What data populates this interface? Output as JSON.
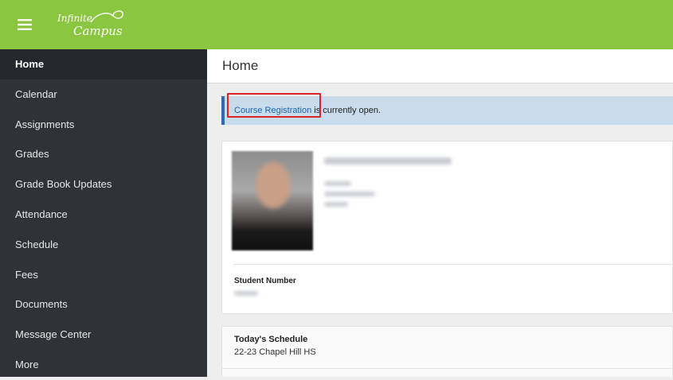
{
  "app": {
    "logo_line1": "Infinite",
    "logo_line2": "Campus",
    "brand_color": "#8ac640",
    "sidebar_color": "#2f3338"
  },
  "sidebar": {
    "items": [
      {
        "label": "Home",
        "active": true
      },
      {
        "label": "Calendar"
      },
      {
        "label": "Assignments"
      },
      {
        "label": "Grades"
      },
      {
        "label": "Grade Book Updates"
      },
      {
        "label": "Attendance"
      },
      {
        "label": "Schedule"
      },
      {
        "label": "Fees"
      },
      {
        "label": "Documents"
      },
      {
        "label": "Message Center"
      },
      {
        "label": "More"
      }
    ]
  },
  "main": {
    "title": "Home",
    "notice": {
      "link_text": "Course Registration",
      "text": " is currently open."
    },
    "student_card": {
      "student_number_label": "Student Number"
    },
    "schedule": {
      "title": "Today's Schedule",
      "school": "22-23 Chapel Hill HS"
    }
  }
}
